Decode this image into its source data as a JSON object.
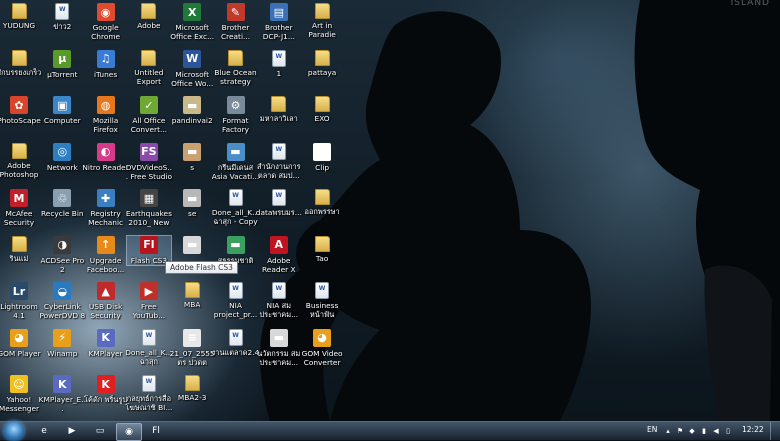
{
  "watermark": "ISLAND",
  "icons": [
    {
      "name": "yudung",
      "label": "YUDUNG",
      "kind": "folder"
    },
    {
      "name": "khao2",
      "label": "ข่าว2",
      "kind": "doc"
    },
    {
      "name": "google-chrome",
      "label": "Google Chrome",
      "kind": "app",
      "glyph": "◉",
      "color": "#e04a2f"
    },
    {
      "name": "adobe",
      "label": "Adobe",
      "kind": "folder"
    },
    {
      "name": "microsoft-office-excel",
      "label": "Microsoft Office Exc...",
      "kind": "app",
      "glyph": "X",
      "color": "#1f7a3a"
    },
    {
      "name": "brother-creative",
      "label": "Brother Creati...",
      "kind": "app",
      "glyph": "✎",
      "color": "#c0392b"
    },
    {
      "name": "brother-dcp",
      "label": "Brother DCP-J1...",
      "kind": "app",
      "glyph": "▤",
      "color": "#3b6fb6"
    },
    {
      "name": "art-in-paradise",
      "label": "Art in Paradie",
      "kind": "folder"
    },
    {
      "name": "sakbrasong",
      "label": "สักบรรยงเกร็ว",
      "kind": "folder"
    },
    {
      "name": "utorrent",
      "label": "µTorrent",
      "kind": "app",
      "glyph": "µ",
      "color": "#5a9a2a"
    },
    {
      "name": "itunes",
      "label": "iTunes",
      "kind": "app",
      "glyph": "♫",
      "color": "#3a7bd5"
    },
    {
      "name": "untitled-export",
      "label": "Untitled Export",
      "kind": "folder"
    },
    {
      "name": "microsoft-office-word",
      "label": "Microsoft Office Wo...",
      "kind": "app",
      "glyph": "W",
      "color": "#2b579a"
    },
    {
      "name": "blue-ocean-strategy",
      "label": "Blue Ocean strategy",
      "kind": "folder"
    },
    {
      "name": "file-1",
      "label": "1",
      "kind": "doc"
    },
    {
      "name": "pattaya",
      "label": "pattaya",
      "kind": "folder"
    },
    {
      "name": "photoscape",
      "label": "PhotoScape",
      "kind": "app",
      "glyph": "✿",
      "color": "#d9452b"
    },
    {
      "name": "computer",
      "label": "Computer",
      "kind": "app",
      "glyph": "▣",
      "color": "#3a86c8"
    },
    {
      "name": "mozilla-firefox",
      "label": "Mozilla Firefox",
      "kind": "app",
      "glyph": "◍",
      "color": "#e8761a"
    },
    {
      "name": "all-office-converter",
      "label": "All Office Convert...",
      "kind": "app",
      "glyph": "✓",
      "color": "#6fa832"
    },
    {
      "name": "pandinvai2",
      "label": "pandinvai2",
      "kind": "app",
      "glyph": "▬",
      "color": "#c9b98a"
    },
    {
      "name": "format-factory",
      "label": "Format Factory",
      "kind": "app",
      "glyph": "⚙",
      "color": "#7a8a99"
    },
    {
      "name": "mahawittayalai",
      "label": "มหาลาวิเลา",
      "kind": "folder"
    },
    {
      "name": "exo",
      "label": "EXO",
      "kind": "folder"
    },
    {
      "name": "adobe-photoshop",
      "label": "Adobe Photoshop ...",
      "kind": "folder"
    },
    {
      "name": "network",
      "label": "Network",
      "kind": "app",
      "glyph": "◎",
      "color": "#2e7fc1"
    },
    {
      "name": "nitro-reader",
      "label": "Nitro Reader",
      "kind": "app",
      "glyph": "◐",
      "color": "#d83a8a"
    },
    {
      "name": "dvdvideosoft",
      "label": "DVDVideoS... Free Studio",
      "kind": "app",
      "glyph": "FS",
      "color": "#8a4aa8"
    },
    {
      "name": "s",
      "label": "s",
      "kind": "app",
      "glyph": "▬",
      "color": "#c9a070"
    },
    {
      "name": "asia-vacation",
      "label": "กรีนมีเดนส Asia Vacati...",
      "kind": "app",
      "glyph": "▬",
      "color": "#4a8ec9"
    },
    {
      "name": "samnak-ngan",
      "label": "สำนักงานการตลาด สมป...",
      "kind": "doc"
    },
    {
      "name": "clip",
      "label": "Clip",
      "kind": "app",
      "glyph": "",
      "color": "#ffffff"
    },
    {
      "name": "mcafee",
      "label": "McAfee Security Sc...",
      "kind": "app",
      "glyph": "M",
      "color": "#c0202a"
    },
    {
      "name": "recycle-bin",
      "label": "Recycle Bin",
      "kind": "app",
      "glyph": "♲",
      "color": "#8aa0b0"
    },
    {
      "name": "registry-mechanic",
      "label": "Registry Mechanic",
      "kind": "app",
      "glyph": "✚",
      "color": "#3a7fc0"
    },
    {
      "name": "earthquakes",
      "label": "Earthquakes 2010_ New ...",
      "kind": "app",
      "glyph": "▦",
      "color": "#444444"
    },
    {
      "name": "se",
      "label": "se",
      "kind": "app",
      "glyph": "▬",
      "color": "#b8b8b8"
    },
    {
      "name": "done-all-copy",
      "label": "Done_all_K... ฉาสุก - Copy",
      "kind": "doc"
    },
    {
      "name": "datapornbai",
      "label": "dataพรบมร...",
      "kind": "doc"
    },
    {
      "name": "aokpraya",
      "label": "ออกพรรษา",
      "kind": "folder"
    },
    {
      "name": "rinnaa",
      "label": "รินแม่",
      "kind": "folder"
    },
    {
      "name": "acdsee-pro",
      "label": "ACDSee Pro 2",
      "kind": "app",
      "glyph": "◑",
      "color": "#3a3a3a"
    },
    {
      "name": "upgrade-facebook",
      "label": "Upgrade Faceboo...",
      "kind": "app",
      "glyph": "↑",
      "color": "#e88a1a"
    },
    {
      "name": "flash-cs3",
      "label": "Flash CS3",
      "kind": "app",
      "glyph": "Fl",
      "color": "#b8141e",
      "selected": true
    },
    {
      "name": "file-blank",
      "label": "",
      "kind": "app",
      "glyph": "▬",
      "color": "#d8d8d8"
    },
    {
      "name": "suthammachat",
      "label": "สุธรรมชาติ",
      "kind": "app",
      "glyph": "▬",
      "color": "#3aa060"
    },
    {
      "name": "adobe-reader-x",
      "label": "Adobe Reader X",
      "kind": "app",
      "glyph": "A",
      "color": "#c0141e"
    },
    {
      "name": "tao",
      "label": "Tao",
      "kind": "folder"
    },
    {
      "name": "lightroom",
      "label": "Lightroom 4.1",
      "kind": "app",
      "glyph": "Lr",
      "color": "#2a4a6a"
    },
    {
      "name": "cyberlink-powerdvd",
      "label": "CyberLink PowerDVD 8",
      "kind": "app",
      "glyph": "◒",
      "color": "#2a7ac0"
    },
    {
      "name": "usb-disk-security",
      "label": "USB Disk Security",
      "kind": "app",
      "glyph": "▲",
      "color": "#c02a2a"
    },
    {
      "name": "free-youtube",
      "label": "Free YouTub...",
      "kind": "app",
      "glyph": "▶",
      "color": "#c0302a"
    },
    {
      "name": "mba",
      "label": "MBA",
      "kind": "folder"
    },
    {
      "name": "nia-project",
      "label": "NIA project_pr...",
      "kind": "doc"
    },
    {
      "name": "nia-som",
      "label": "NIA สม ประชาคม...",
      "kind": "doc"
    },
    {
      "name": "business",
      "label": "Business หน้าฟัน",
      "kind": "doc"
    },
    {
      "name": "gom-player",
      "label": "GOM Player",
      "kind": "app",
      "glyph": "◕",
      "color": "#e8a01a"
    },
    {
      "name": "winamp",
      "label": "Winamp",
      "kind": "app",
      "glyph": "⚡",
      "color": "#e8a01a"
    },
    {
      "name": "kmplayer",
      "label": "KMPlayer",
      "kind": "app",
      "glyph": "K",
      "color": "#5a6ac0"
    },
    {
      "name": "done-all",
      "label": "Done_all_K... ฉาสุก",
      "kind": "doc"
    },
    {
      "name": "date-21-07-2555",
      "label": "21_07_2555 ตร ปวดต",
      "kind": "app",
      "glyph": "≡",
      "color": "#e8e8e8"
    },
    {
      "name": "ngan-tasat",
      "label": "งานแตลาด2.4",
      "kind": "doc"
    },
    {
      "name": "nawatkam",
      "label": "นวัตกรรม สม ประชาคม...",
      "kind": "app",
      "glyph": "▬",
      "color": "#d8d8d8"
    },
    {
      "name": "gom-video-converter",
      "label": "GOM Video Converter",
      "kind": "app",
      "glyph": "◕",
      "color": "#e8a01a"
    },
    {
      "name": "yahoo-messenger",
      "label": "Yahoo! Messenger",
      "kind": "app",
      "glyph": "☺",
      "color": "#f0c020"
    },
    {
      "name": "kmplayer-e",
      "label": "KMPlayer_E...",
      "kind": "app",
      "glyph": "K",
      "color": "#5a6ac0"
    },
    {
      "name": "kodak-photo",
      "label": "โค้ดัก พริ้นรูป",
      "kind": "app",
      "glyph": "K",
      "color": "#e02020"
    },
    {
      "name": "kodsthai",
      "label": "กลยุทธ์การสื่อ โฆษณาซิ BI...",
      "kind": "doc"
    },
    {
      "name": "mba2-3",
      "label": "MBA2-3",
      "kind": "folder"
    }
  ],
  "tooltip": "Adobe Flash CS3",
  "taskbar": {
    "pinned": [
      {
        "name": "ie",
        "glyph": "e"
      },
      {
        "name": "media-player",
        "glyph": "▶"
      },
      {
        "name": "explorer",
        "glyph": "▭"
      },
      {
        "name": "chrome",
        "glyph": "◉",
        "active": true
      },
      {
        "name": "flash-taskbar",
        "glyph": "Fl"
      }
    ],
    "language": "EN",
    "clock": "12:22"
  }
}
